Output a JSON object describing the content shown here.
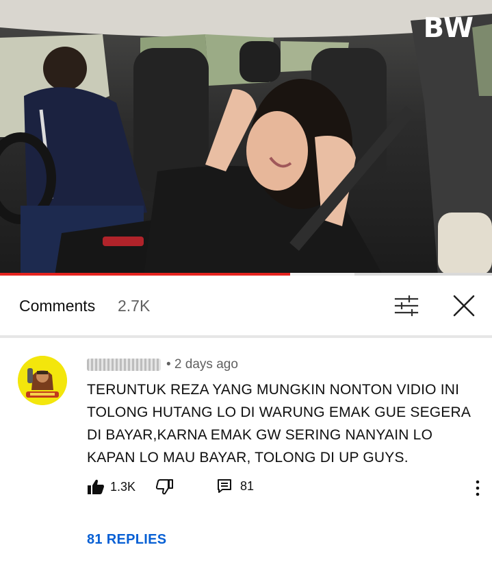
{
  "video": {
    "watermark": "BW",
    "progress_fraction": 0.59,
    "buffered_fraction": 0.72,
    "colors": {
      "progress": "#e52420",
      "buffer": "#f2f2f2",
      "track": "#d9d9d9"
    }
  },
  "comments_header": {
    "title": "Comments",
    "count": "2.7K",
    "filter_icon": "sort-sliders-icon",
    "close_icon": "close-x-icon"
  },
  "comment": {
    "avatar_icon": "cartoon-avatar",
    "time": "• 2 days ago",
    "text": "TERUNTUK REZA YANG MUNGKIN NONTON VIDIO INI TOLONG HUTANG LO DI WARUNG EMAK GUE SEGERA DI BAYAR,KARNA EMAK GW SERING NANYAIN LO KAPAN LO MAU BAYAR, TOLONG DI UP GUYS.",
    "likes": "1.3K",
    "replies_count": "81",
    "replies_link": "81 REPLIES",
    "icons": {
      "like": "thumbs-up-icon",
      "dislike": "thumbs-down-icon",
      "reply": "comment-icon",
      "more": "more-vertical-icon"
    },
    "link_color": "#065fd4"
  }
}
